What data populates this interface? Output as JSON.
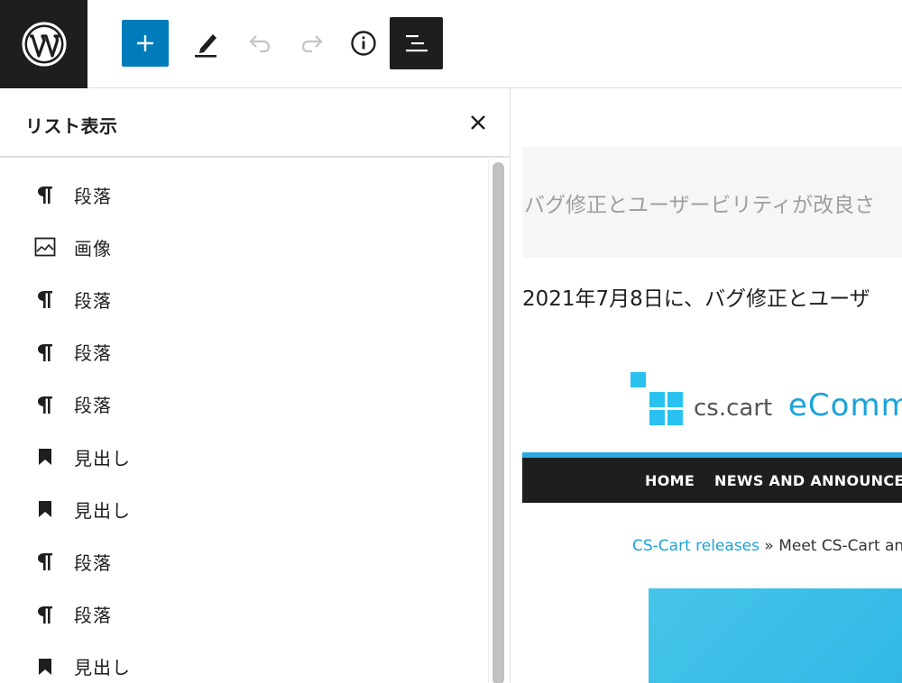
{
  "toolbar": {
    "logo_icon": "wordpress-logo-icon",
    "add_icon": "plus-icon",
    "edit_icon": "pencil-icon",
    "undo_icon": "undo-icon",
    "redo_icon": "redo-icon",
    "info_icon": "info-icon",
    "list_view_icon": "list-view-icon",
    "accent_color": "#007cba"
  },
  "list_panel": {
    "title": "リスト表示",
    "close_icon": "close-icon",
    "items": [
      {
        "icon": "paragraph-icon",
        "label": "段落"
      },
      {
        "icon": "image-icon",
        "label": "画像"
      },
      {
        "icon": "paragraph-icon",
        "label": "段落"
      },
      {
        "icon": "paragraph-icon",
        "label": "段落"
      },
      {
        "icon": "paragraph-icon",
        "label": "段落"
      },
      {
        "icon": "bookmark-icon",
        "label": "見出し"
      },
      {
        "icon": "bookmark-icon",
        "label": "見出し"
      },
      {
        "icon": "paragraph-icon",
        "label": "段落"
      },
      {
        "icon": "paragraph-icon",
        "label": "段落"
      },
      {
        "icon": "bookmark-icon",
        "label": "見出し"
      }
    ]
  },
  "canvas": {
    "excerpt": "バグ修正とユーザービリティが改良さ",
    "paragraph": "2021年7月8日に、バグ修正とユーザ",
    "image": {
      "logo_name": "cs.cart",
      "logo_tagline": "eComm",
      "nav_home": "HOME",
      "nav_news": "NEWS AND ANNOUNCEME",
      "breadcrumb_link": "CS-Cart releases",
      "breadcrumb_sep": " » ",
      "breadcrumb_text": "Meet CS-Cart an",
      "brand_color": "#1ba3d8"
    }
  }
}
